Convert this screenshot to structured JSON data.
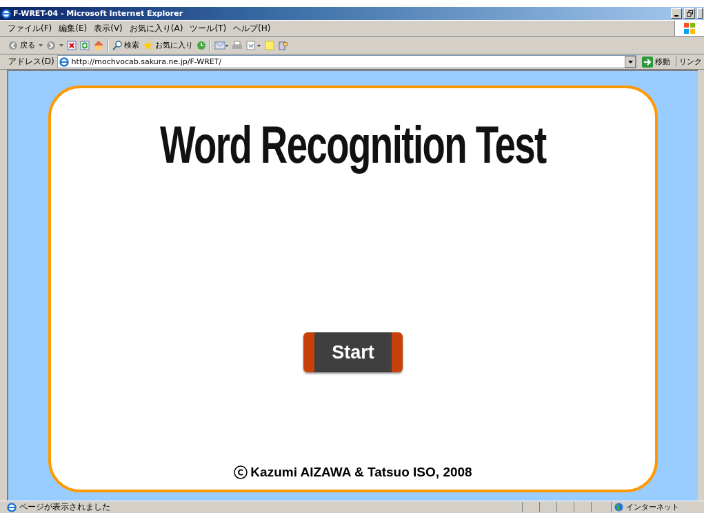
{
  "window": {
    "title": "F-WRET-04 - Microsoft Internet Explorer"
  },
  "menu": [
    "ファイル(F)",
    "編集(E)",
    "表示(V)",
    "お気に入り(A)",
    "ツール(T)",
    "ヘルプ(H)"
  ],
  "toolbar": {
    "back": "戻る",
    "search": "検索",
    "favorites": "お気に入り"
  },
  "address_bar": {
    "label": "アドレス(D)",
    "value": "http://mochvocab.sakura.ne.jp/F-WRET/",
    "go": "移動",
    "links": "リンク"
  },
  "page": {
    "title": "Word Recognition Test",
    "start_button": "Start",
    "copyright": "Kazumi AIZAWA & Tatsuo ISO, 2008"
  },
  "status_bar": {
    "text": "ページが表示されました",
    "zone": "インターネット"
  }
}
